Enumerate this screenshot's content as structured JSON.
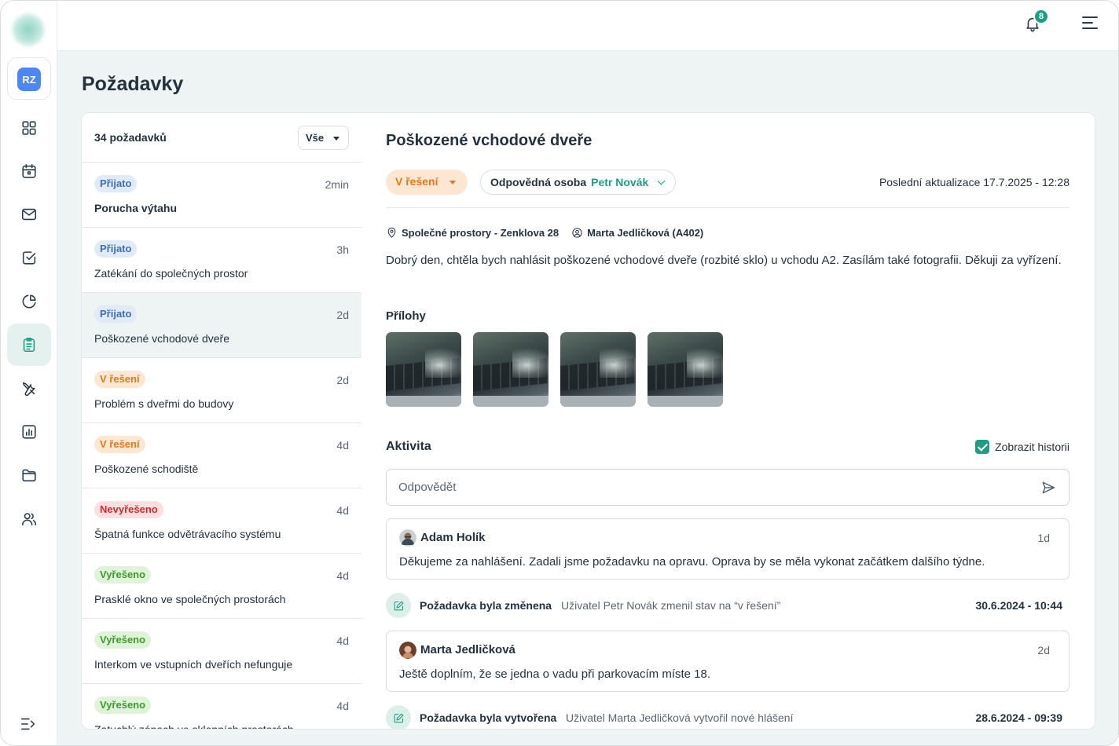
{
  "user": {
    "initials": "RZ"
  },
  "notifications": {
    "count": "8"
  },
  "page": {
    "title": "Požadavky"
  },
  "list": {
    "count_label": "34 požadavků",
    "filter_label": "Vše",
    "items": [
      {
        "status": "Přijato",
        "status_type": "prijato",
        "time": "2min",
        "title": "Porucha výtahu"
      },
      {
        "status": "Přijato",
        "status_type": "prijato",
        "time": "3h",
        "title": "Zatékání do společných prostor"
      },
      {
        "status": "Přijato",
        "status_type": "prijato",
        "time": "2d",
        "title": "Poškozené vchodové dveře"
      },
      {
        "status": "V řešení",
        "status_type": "reseni",
        "time": "2d",
        "title": "Problém s dveřmi do budovy"
      },
      {
        "status": "V řešení",
        "status_type": "reseni",
        "time": "4d",
        "title": "Poškozené schodiště"
      },
      {
        "status": "Nevyřešeno",
        "status_type": "nevyreseno",
        "time": "4d",
        "title": "Špatná funkce odvětrávacího systému"
      },
      {
        "status": "Vyřešeno",
        "status_type": "vyreseno",
        "time": "4d",
        "title": "Prasklé okno ve společných prostorách"
      },
      {
        "status": "Vyřešeno",
        "status_type": "vyreseno",
        "time": "4d",
        "title": "Interkom ve vstupních dveřích nefunguje"
      },
      {
        "status": "Vyřešeno",
        "status_type": "vyreseno",
        "time": "4d",
        "title": "Zatuchlý zápach ve sklepních prostorách"
      }
    ]
  },
  "detail": {
    "title": "Poškozené vchodové dveře",
    "status": "V řešení",
    "owner_label": "Odpovědná osoba",
    "owner_name": "Petr Novák",
    "last_update": "Poslední aktualizace 17.7.2025 - 12:28",
    "location": "Společné prostory - Zenklova 28",
    "reporter": "Marta Jedličková (A402)",
    "description": "Dobrý den, chtěla bych nahlásit poškozené vchodové dveře (rozbité sklo) u vchodu A2. Zasílám také fotografii. Děkuji za vyřízení.",
    "attachments_label": "Přílohy",
    "attachments_count": 4,
    "activity_label": "Aktivita",
    "show_history_label": "Zobrazit historii",
    "show_history_checked": true,
    "reply_placeholder": "Odpovědět",
    "comments": [
      {
        "author": "Adam Holík",
        "time": "1d",
        "text": "Děkujeme za nahlášení. Zadali jsme požadavku na opravu. Oprava by se měla vykonat začátkem dalšího týdne."
      },
      {
        "author": "Marta Jedličková",
        "time": "2d",
        "text": "Ještě doplním, že se jedna o vadu při parkovacím míste 18."
      }
    ],
    "events": [
      {
        "title": "Požadavka byla změnena",
        "desc": "Uživatel Petr Novák zmenil stav na “v řešení”",
        "date": "30.6.2024 - 10:44"
      },
      {
        "title": "Požadavka byla vytvořena",
        "desc": "Uživatel Marta Jedličková vytvořil nové hlášení",
        "date": "28.6.2024 - 09:39"
      }
    ]
  },
  "colors": {
    "accent": "#1f9d83",
    "primary_blue": "#4f86f7",
    "status_prijato": "#3f6fb0",
    "status_reseni": "#e07a1f",
    "status_nevyreseno": "#d12b2b",
    "status_vyreseno": "#3e9a2a"
  },
  "icons": {
    "sidebar": [
      "dashboard-icon",
      "calendar-icon",
      "mail-icon",
      "tasks-icon",
      "pie-chart-icon",
      "clipboard-icon",
      "tools-icon",
      "bar-chart-icon",
      "folder-icon",
      "users-icon"
    ],
    "topbar": [
      "bell-icon",
      "menu-icon"
    ],
    "bottom": "collapse-sidebar-icon"
  }
}
